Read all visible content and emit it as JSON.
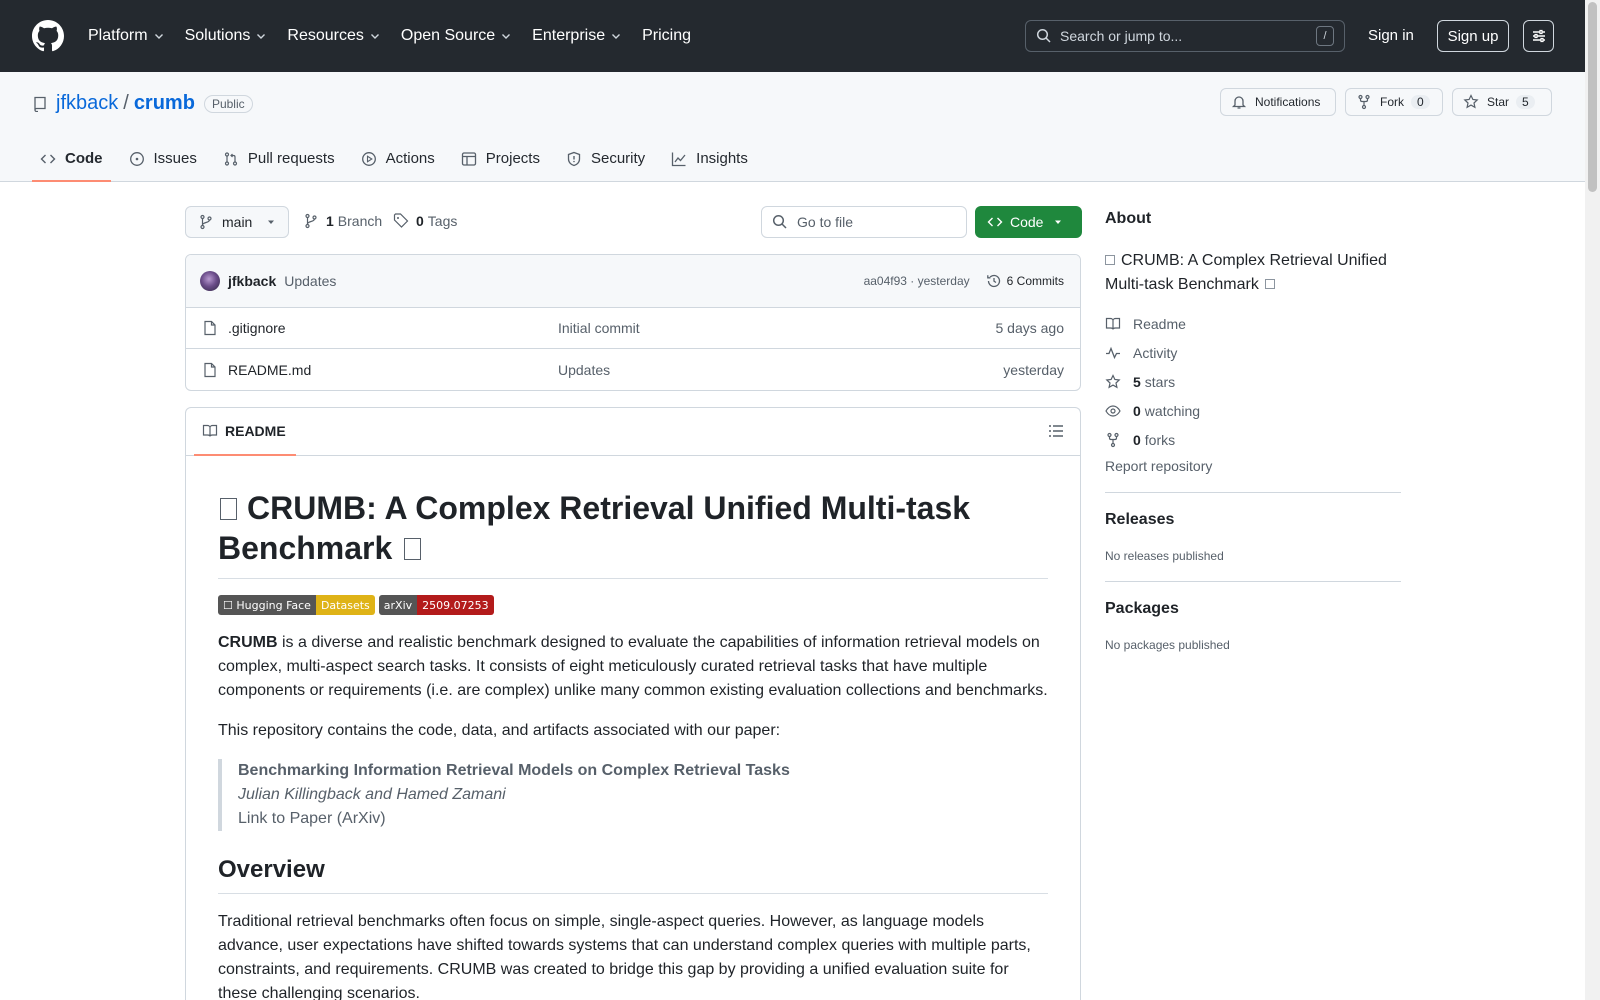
{
  "header": {
    "nav": [
      "Platform",
      "Solutions",
      "Resources",
      "Open Source",
      "Enterprise",
      "Pricing"
    ],
    "search_placeholder": "Search or jump to...",
    "search_shortcut": "/",
    "signin": "Sign in",
    "signup": "Sign up"
  },
  "repo": {
    "owner": "jfkback",
    "separator": "/",
    "name": "crumb",
    "visibility": "Public",
    "notifications_label": "Notifications",
    "fork_label": "Fork",
    "fork_count": "0",
    "star_label": "Star",
    "star_count": "5"
  },
  "tabs": [
    "Code",
    "Issues",
    "Pull requests",
    "Actions",
    "Projects",
    "Security",
    "Insights"
  ],
  "toolbar": {
    "branch": "main",
    "branch_count": "1",
    "branch_label": "Branch",
    "tag_count": "0",
    "tag_label": "Tags",
    "goto_placeholder": "Go to file",
    "code_button": "Code"
  },
  "latest_commit": {
    "author": "jfkback",
    "message": "Updates",
    "hash_time": "aa04f93 · yesterday",
    "commits": "6 Commits"
  },
  "files": [
    {
      "name": ".gitignore",
      "message": "Initial commit",
      "date": "5 days ago"
    },
    {
      "name": "README.md",
      "message": "Updates",
      "date": "yesterday"
    }
  ],
  "readme": {
    "tab_label": "README",
    "title": "CRUMB: A Complex Retrieval Unified Multi-task Benchmark",
    "badges": [
      {
        "left": "☐ Hugging Face",
        "right": "Datasets",
        "color": "#dfb317"
      },
      {
        "left": "arXiv",
        "right": "2509.07253",
        "color": "#b31b1b"
      }
    ],
    "intro_bold": "CRUMB",
    "intro_rest": " is a diverse and realistic benchmark designed to evaluate the capabilities of information retrieval models on complex, multi-aspect search tasks. It consists of eight meticulously curated retrieval tasks that have multiple components or requirements (i.e. are complex) unlike many common existing evaluation collections and benchmarks.",
    "repo_line": "This repository contains the code, data, and artifacts associated with our paper:",
    "paper_title": "Benchmarking Information Retrieval Models on Complex Retrieval Tasks",
    "paper_authors": "Julian Killingback and Hamed Zamani",
    "paper_link": "Link to Paper (ArXiv)",
    "overview_heading": "Overview",
    "overview_text": "Traditional retrieval benchmarks often focus on simple, single-aspect queries. However, as language models advance, user expectations have shifted towards systems that can understand complex queries with multiple parts, constraints, and requirements. CRUMB was created to bridge this gap by providing a unified evaluation suite for these challenging scenarios."
  },
  "sidebar": {
    "about_heading": "About",
    "description": "CRUMB: A Complex Retrieval Unified Multi-task Benchmark",
    "readme": "Readme",
    "activity": "Activity",
    "stars_count": "5",
    "stars_label": "stars",
    "watching_count": "0",
    "watching_label": "watching",
    "forks_count": "0",
    "forks_label": "forks",
    "report": "Report repository",
    "releases_heading": "Releases",
    "releases_text": "No releases published",
    "packages_heading": "Packages",
    "packages_text": "No packages published"
  }
}
